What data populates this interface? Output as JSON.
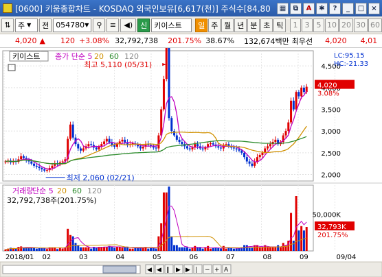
{
  "window": {
    "title": "[0600] 키움종합차트 - KOSDAQ 외국인보유[6,617(천)] 주식수[84,80"
  },
  "toolbar": {
    "market": "주",
    "label_jeon": "전",
    "code": "054780",
    "stock_name": "키이스트",
    "periods": [
      "일",
      "주",
      "월",
      "년",
      "분",
      "초",
      "틱"
    ],
    "active_period": "일",
    "intervals": [
      "1",
      "3",
      "5",
      "10",
      "20",
      "30",
      "60"
    ]
  },
  "info": {
    "price": "4,020",
    "change": "120",
    "change_pct": "+3.08%",
    "volume": "32,792,738",
    "volume_ratio": "201.75%",
    "turnover": "38.67%",
    "amount": "132,674백만",
    "best_ask_label": "최우선",
    "ask": "4,020",
    "bid": "4,01"
  },
  "chart_data": {
    "type": "candlestick",
    "price_panel": {
      "title_name": "키이스트",
      "legend": [
        "종가 단순 5",
        "20",
        "60",
        "120"
      ],
      "legend_colors": [
        "#c000c0",
        "#d09000",
        "#2a8a2a",
        "#8a8a8a"
      ],
      "lc": "LC:95.15",
      "hc": "HC:-21.33",
      "high_label": "최고 5,110 (05/31)",
      "low_label": "최저 2,060 (02/21)",
      "current_price_label": "4,020",
      "current_change_label": "3.08%",
      "y_ticks": [
        "4,500",
        "4,000",
        "3,500",
        "3,000",
        "2,500",
        "2,000"
      ],
      "y_values": [
        4500,
        4000,
        3500,
        3000,
        2500,
        2000
      ],
      "ylim": [
        1850,
        4850
      ],
      "closes": [
        2300,
        2320,
        2280,
        2310,
        2290,
        2350,
        2420,
        2380,
        2330,
        2300,
        2250,
        2200,
        2180,
        2150,
        2120,
        2090,
        2100,
        2150,
        2200,
        2250,
        2240,
        2280,
        2300,
        2350,
        2820,
        3150,
        2850,
        2700,
        2600,
        2550,
        2600,
        2650,
        2700,
        2680,
        2620,
        2580,
        2640,
        2700,
        2760,
        2820,
        2740,
        2680,
        2640,
        2700,
        2760,
        2800,
        2740,
        2680,
        2700,
        2720,
        2690,
        2650,
        2600,
        2640,
        2700,
        2680,
        2650,
        2620,
        2600,
        2900,
        3500,
        4200,
        4950,
        3300,
        3000,
        2900,
        2800,
        2750,
        2700,
        2650,
        2600,
        2580,
        2620,
        2700,
        2650,
        2600,
        2580,
        2620,
        2700,
        2720,
        2690,
        2650,
        2620,
        2600,
        2680,
        2700,
        2650,
        2620,
        2600,
        2580,
        2550,
        2500,
        2400,
        2300,
        2250,
        2200,
        2300,
        2400,
        2450,
        2500,
        2600,
        2650,
        2700,
        2750,
        2800,
        2700,
        2750,
        2900,
        3000,
        3200,
        3700,
        3500,
        3900,
        3800,
        4000,
        3900,
        4020
      ],
      "ma5_color": "#c000c0",
      "ma20_color": "#d09000",
      "ma60_color": "#2a8a2a"
    },
    "volume_panel": {
      "legend": [
        "거래량",
        "단순 5",
        "20",
        "60",
        "120"
      ],
      "legend_colors": [
        "#c000c0",
        "#c000c0",
        "#d09000",
        "#2a8a2a",
        "#8a8a8a"
      ],
      "volume_text": "32,792,738주(201.75%)",
      "y_tick": "50,000K",
      "current_volume_label": "32,793K",
      "current_pct_label": "201.75%",
      "ylim": [
        0,
        90000
      ]
    },
    "x_ticks": [
      "2018/01",
      "02",
      "03",
      "04",
      "05",
      "06",
      "07",
      "08",
      "09",
      "09/04"
    ]
  }
}
